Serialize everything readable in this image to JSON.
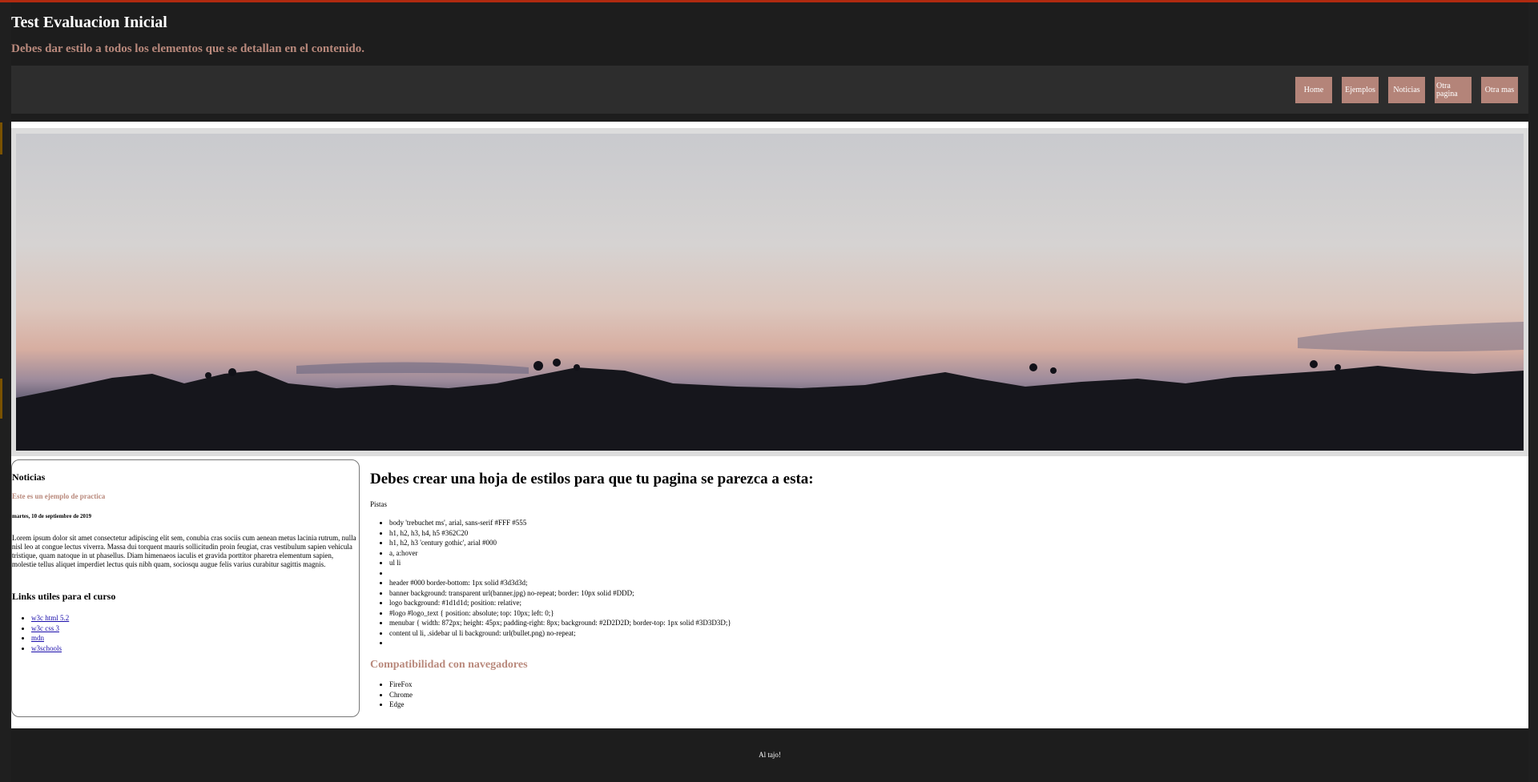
{
  "header": {
    "title": "Test Evaluacion Inicial",
    "subtitle": "Debes dar estilo a todos los elementos que se detallan en el contenido."
  },
  "menu": [
    {
      "label": "Home"
    },
    {
      "label": "Ejemplos"
    },
    {
      "label": "Noticias"
    },
    {
      "label": "Otra pagina"
    },
    {
      "label": "Otra mas"
    }
  ],
  "sidebar": {
    "heading": "Noticias",
    "news_title": "Este es un ejemplo de practica",
    "news_date": "martes, 10 de septiembre de 2019",
    "news_body": "Lorem ipsum dolor sit amet consectetur adipiscing elit sem, conubia cras sociis cum aenean metus lacinia rutrum, nulla nisl leo at congue lectus viverra. Massa dui torquent mauris sollicitudin proin feugiat, cras vestibulum sapien vehicula tristique, quam natoque in ut phasellus. Diam himenaeos iaculis et gravida porttitor pharetra elementum sapien, molestie tellus aliquet imperdiet lectus quis nibh quam, sociosqu augue felis varius curabitur sagittis magnis.",
    "links_heading": "Links utiles para el curso",
    "links": [
      {
        "label": "w3c html 5.2"
      },
      {
        "label": "w3c css 3"
      },
      {
        "label": "mdn"
      },
      {
        "label": "w3schools"
      }
    ]
  },
  "content": {
    "heading": "Debes crear una hoja de estilos para que tu pagina se parezca a esta:",
    "hints_label": "Pistas",
    "hints": [
      "body 'trebuchet ms', arial, sans-serif #FFF #555",
      "h1, h2, h3, h4, h5 #362C20",
      "h1, h2, h3 'century gothic', arial #000",
      "a, a:hover",
      "ul li",
      "",
      "header #000 border-bottom: 1px solid #3d3d3d;",
      "banner background: transparent url(banner.jpg) no-repeat; border: 10px solid #DDD;",
      "logo background: #1d1d1d; position: relative;",
      "#logo #logo_text { position: absolute; top: 10px; left: 0;}",
      "menubar { width: 872px; height: 45px; padding-right: 8px; background: #2D2D2D; border-top: 1px solid #3D3D3D;}",
      "content ul li, .sidebar ul li background: url(bullet.png) no-repeat;",
      ""
    ],
    "compat_heading": "Compatibilidad con navegadores",
    "browsers": [
      "FireFox",
      "Chrome",
      "Edge"
    ]
  },
  "footer": {
    "text": "Al tajo!"
  },
  "colors": {
    "header_bg": "#1d1d1d",
    "menubar_bg": "#2d2d2d",
    "menu_button": "#b48479",
    "accent_text": "#b9897c",
    "banner_border": "#dddddd",
    "top_line": "#b02a10"
  }
}
